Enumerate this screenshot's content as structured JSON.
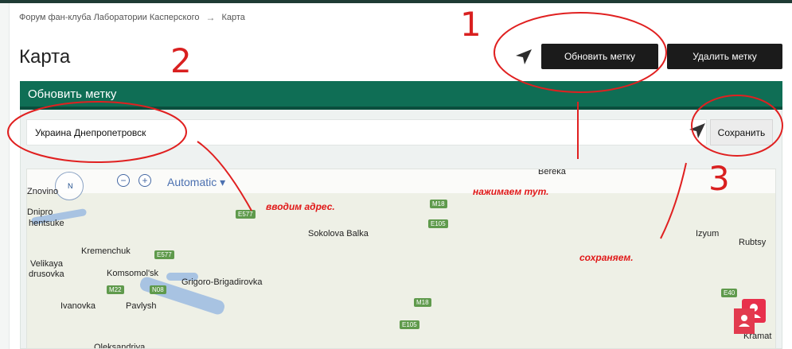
{
  "breadcrumb": {
    "forum": "Форум фан-клуба Лаборатории Касперского",
    "separator": "→",
    "current": "Карта"
  },
  "page": {
    "title": "Карта"
  },
  "toolbar": {
    "update_label": "Обновить метку",
    "delete_label": "Удалить метку"
  },
  "panel": {
    "header": "Обновить метку",
    "address_value": "Украина Днепропетровск",
    "save_label": "Сохранить"
  },
  "map": {
    "compass_label": "N",
    "zoom_out": "−",
    "zoom_in": "+",
    "type_label": "Automatic ▾",
    "places": [
      {
        "name": "Znovino"
      },
      {
        "name": "Dnipro"
      },
      {
        "name": "hentsuke"
      },
      {
        "name": "Kremenchuk"
      },
      {
        "name": "Velikaya"
      },
      {
        "name": "drusovka"
      },
      {
        "name": "Komsomol'sk"
      },
      {
        "name": "Grigoro-Brigadirovka"
      },
      {
        "name": "Ivanovka"
      },
      {
        "name": "Pavlysh"
      },
      {
        "name": "Sokolova Balka"
      },
      {
        "name": "Bereka"
      },
      {
        "name": "Izyum"
      },
      {
        "name": "Rubtsy"
      },
      {
        "name": "Oleksandriya"
      },
      {
        "name": "Kramat"
      }
    ],
    "roads": [
      "E577",
      "E577",
      "M18",
      "E105",
      "M22",
      "N08",
      "M18",
      "E105",
      "E40"
    ]
  },
  "annotations": {
    "n1": "1",
    "n2": "2",
    "n3": "3",
    "enter_address": "вводим адрес.",
    "click_here": "нажимаем тут.",
    "save": "сохраняем."
  },
  "colors": {
    "header_green": "#0f6e55",
    "button_dark": "#1b1b1b",
    "annotation_red": "#e01818"
  }
}
